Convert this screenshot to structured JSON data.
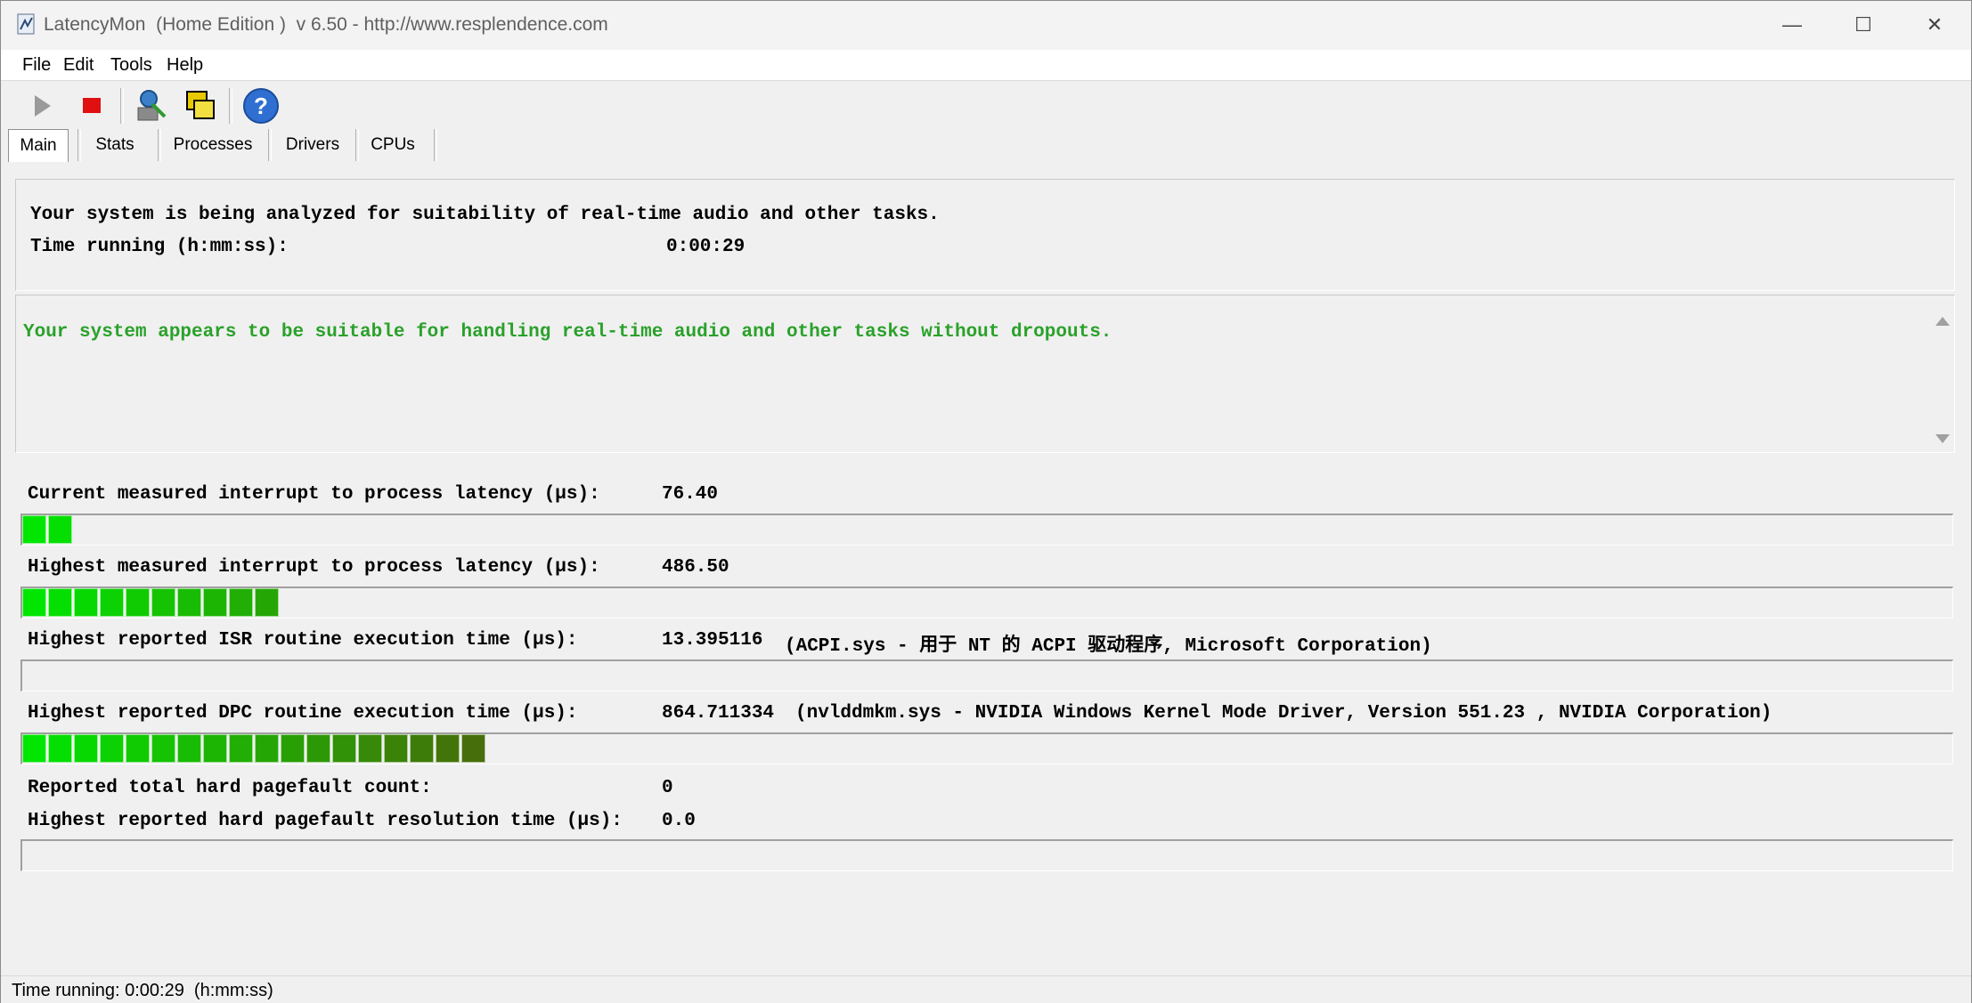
{
  "window": {
    "title": "LatencyMon  (Home Edition )  v 6.50 - http://www.resplendence.com",
    "minimize": "—",
    "maximize": "☐",
    "close": "✕"
  },
  "menu": {
    "file": "File",
    "edit": "Edit",
    "tools": "Tools",
    "help": "Help"
  },
  "toolbar": {
    "start_icon": "play-icon",
    "stop_icon": "stop-icon",
    "tool_icon": "analyze-icon",
    "windows_icon": "windows-icon",
    "help_icon": "help-icon"
  },
  "tabs": [
    "Main",
    "Stats",
    "Processes",
    "Drivers",
    "CPUs"
  ],
  "analysis": {
    "line1": "Your system is being analyzed for suitability of real-time audio and other tasks.",
    "time_label": "Time running (h:mm:ss):",
    "time_value": "0:00:29"
  },
  "verdict": {
    "message": "Your system appears to be suitable for handling real-time audio and other tasks without dropouts.",
    "color": "#2aa12a"
  },
  "metrics": {
    "current_label": "Current measured interrupt to process latency (µs):",
    "current_value": "76.40",
    "current_segments": 2,
    "highest_label": "Highest measured interrupt to process latency (µs):",
    "highest_value": "486.50",
    "highest_segments": 10,
    "isr_label": "Highest reported ISR routine execution time (µs):",
    "isr_value": "13.395116",
    "isr_detail": "(ACPI.sys - 用于 NT 的 ACPI 驱动程序, Microsoft Corporation)",
    "isr_segments": 0,
    "dpc_label": "Highest reported DPC routine execution time (µs):",
    "dpc_value": "864.711334",
    "dpc_detail": "(nvlddmkm.sys - NVIDIA Windows Kernel Mode Driver, Version 551.23 , NVIDIA Corporation)",
    "dpc_segments": 18,
    "pagefault_count_label": "Reported total hard pagefault count:",
    "pagefault_count_value": "0",
    "pagefault_time_label": "Highest reported hard pagefault resolution time (µs):",
    "pagefault_time_value": "0.0",
    "pagefault_segments": 0
  },
  "status": {
    "text": "Time running: 0:00:29  (h:mm:ss)"
  }
}
